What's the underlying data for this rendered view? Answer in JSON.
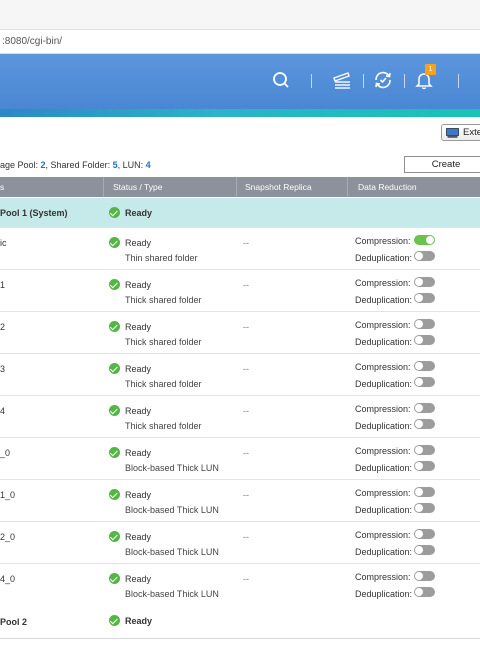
{
  "browser": {
    "url": ":8080/cgi-bin/"
  },
  "header": {
    "notification_count": "1",
    "accent_color": "#4a87d3"
  },
  "toolbar": {
    "external_button_label": "Exte",
    "create_button_label": "Create"
  },
  "summary": {
    "prefix": "age Pool: ",
    "pool_count": "2",
    "folder_label": ", Shared Folder: ",
    "folder_count": "5",
    "lun_label": ", LUN: ",
    "lun_count": "4"
  },
  "table": {
    "columns": [
      "s",
      "Status / Type",
      "Snapshot Replica",
      "Data Reduction"
    ],
    "compression_label": "Compression:",
    "dedup_label": "Deduplication:",
    "pool1": {
      "name": "Pool 1 (System)",
      "status": "Ready"
    },
    "rows": [
      {
        "name": "ic",
        "status": "Ready",
        "type": "Thin shared folder",
        "replica": "--",
        "compression": true,
        "dedup": false
      },
      {
        "name": "1",
        "status": "Ready",
        "type": "Thick shared folder",
        "replica": "--",
        "compression": false,
        "dedup": false
      },
      {
        "name": "2",
        "status": "Ready",
        "type": "Thick shared folder",
        "replica": "--",
        "compression": false,
        "dedup": false
      },
      {
        "name": "3",
        "status": "Ready",
        "type": "Thick shared folder",
        "replica": "--",
        "compression": false,
        "dedup": false
      },
      {
        "name": "4",
        "status": "Ready",
        "type": "Thick shared folder",
        "replica": "--",
        "compression": false,
        "dedup": false
      },
      {
        "name": "_0",
        "status": "Ready",
        "type": "Block-based Thick LUN",
        "replica": "--",
        "compression": false,
        "dedup": false
      },
      {
        "name": "1_0",
        "status": "Ready",
        "type": "Block-based Thick LUN",
        "replica": "--",
        "compression": false,
        "dedup": false
      },
      {
        "name": "2_0",
        "status": "Ready",
        "type": "Block-based Thick LUN",
        "replica": "--",
        "compression": false,
        "dedup": false
      },
      {
        "name": "4_0",
        "status": "Ready",
        "type": "Block-based Thick LUN",
        "replica": "--",
        "compression": false,
        "dedup": false
      }
    ],
    "pool2": {
      "name": "Pool 2",
      "status": "Ready"
    }
  },
  "icons": [
    "search-icon",
    "tasks-icon",
    "sync-icon",
    "bell-icon",
    "external-device-icon",
    "ready-check-icon"
  ]
}
